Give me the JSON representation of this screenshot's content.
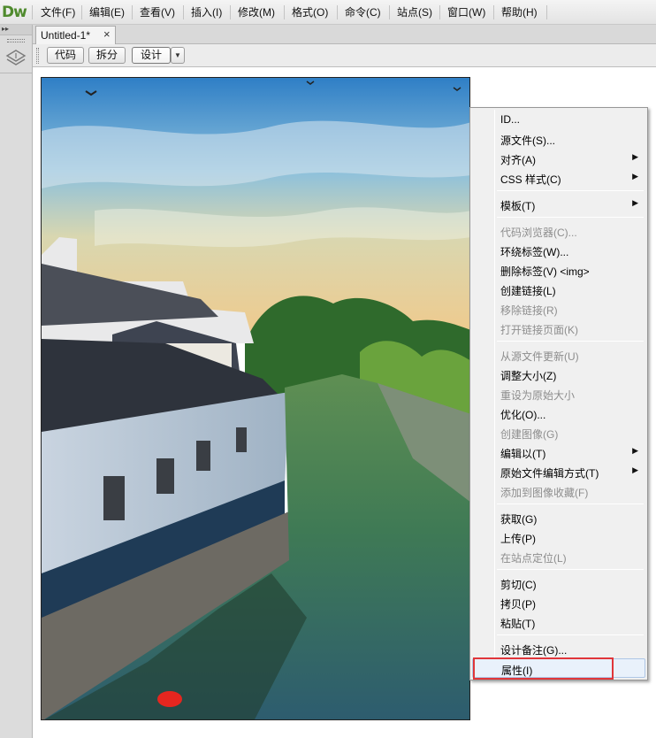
{
  "app": {
    "logo": "Dw"
  },
  "menubar": {
    "items": [
      {
        "label": "文件(F)"
      },
      {
        "label": "编辑(E)"
      },
      {
        "label": "查看(V)"
      },
      {
        "label": "插入(I)"
      },
      {
        "label": "修改(M)"
      },
      {
        "label": "格式(O)"
      },
      {
        "label": "命令(C)"
      },
      {
        "label": "站点(S)"
      },
      {
        "label": "窗口(W)"
      },
      {
        "label": "帮助(H)"
      }
    ]
  },
  "doc_tab": {
    "title": "Untitled-1*",
    "close": "×"
  },
  "view_toolbar": {
    "code": "代码",
    "split": "拆分",
    "design": "设计",
    "active": "design"
  },
  "context_menu": {
    "items": [
      {
        "label": "ID...",
        "enabled": true,
        "submenu": false
      },
      {
        "label": "源文件(S)...",
        "enabled": true,
        "submenu": false
      },
      {
        "label": "对齐(A)",
        "enabled": true,
        "submenu": true
      },
      {
        "label": "CSS 样式(C)",
        "enabled": true,
        "submenu": true
      },
      {
        "separator": true
      },
      {
        "label": "模板(T)",
        "enabled": true,
        "submenu": true
      },
      {
        "separator": true
      },
      {
        "label": "代码浏览器(C)...",
        "enabled": false,
        "submenu": false
      },
      {
        "label": "环绕标签(W)...",
        "enabled": true,
        "submenu": false
      },
      {
        "label": "删除标签(V) <img>",
        "enabled": true,
        "submenu": false
      },
      {
        "label": "创建链接(L)",
        "enabled": true,
        "submenu": false
      },
      {
        "label": "移除链接(R)",
        "enabled": false,
        "submenu": false
      },
      {
        "label": "打开链接页面(K)",
        "enabled": false,
        "submenu": false
      },
      {
        "separator": true
      },
      {
        "label": "从源文件更新(U)",
        "enabled": false,
        "submenu": false
      },
      {
        "label": "调整大小(Z)",
        "enabled": true,
        "submenu": false
      },
      {
        "label": "重设为原始大小",
        "enabled": false,
        "submenu": false
      },
      {
        "label": "优化(O)...",
        "enabled": true,
        "submenu": false
      },
      {
        "label": "创建图像(G)",
        "enabled": false,
        "submenu": false
      },
      {
        "label": "编辑以(T)",
        "enabled": true,
        "submenu": true
      },
      {
        "label": "原始文件编辑方式(T)",
        "enabled": true,
        "submenu": true
      },
      {
        "label": "添加到图像收藏(F)",
        "enabled": false,
        "submenu": false
      },
      {
        "separator": true
      },
      {
        "label": "获取(G)",
        "enabled": true,
        "submenu": false
      },
      {
        "label": "上传(P)",
        "enabled": true,
        "submenu": false
      },
      {
        "label": "在站点定位(L)",
        "enabled": false,
        "submenu": false
      },
      {
        "separator": true
      },
      {
        "label": "剪切(C)",
        "enabled": true,
        "submenu": false
      },
      {
        "label": "拷贝(P)",
        "enabled": true,
        "submenu": false
      },
      {
        "label": "粘贴(T)",
        "enabled": true,
        "submenu": false
      },
      {
        "separator": true
      },
      {
        "label": "设计备注(G)...",
        "enabled": true,
        "submenu": false
      },
      {
        "label": "属性(I)",
        "enabled": true,
        "submenu": false,
        "highlighted": true
      }
    ]
  },
  "colors": {
    "logo_green": "#4f8a2d",
    "highlight_red": "#e0363a",
    "disabled_text": "#8d8d8d"
  }
}
